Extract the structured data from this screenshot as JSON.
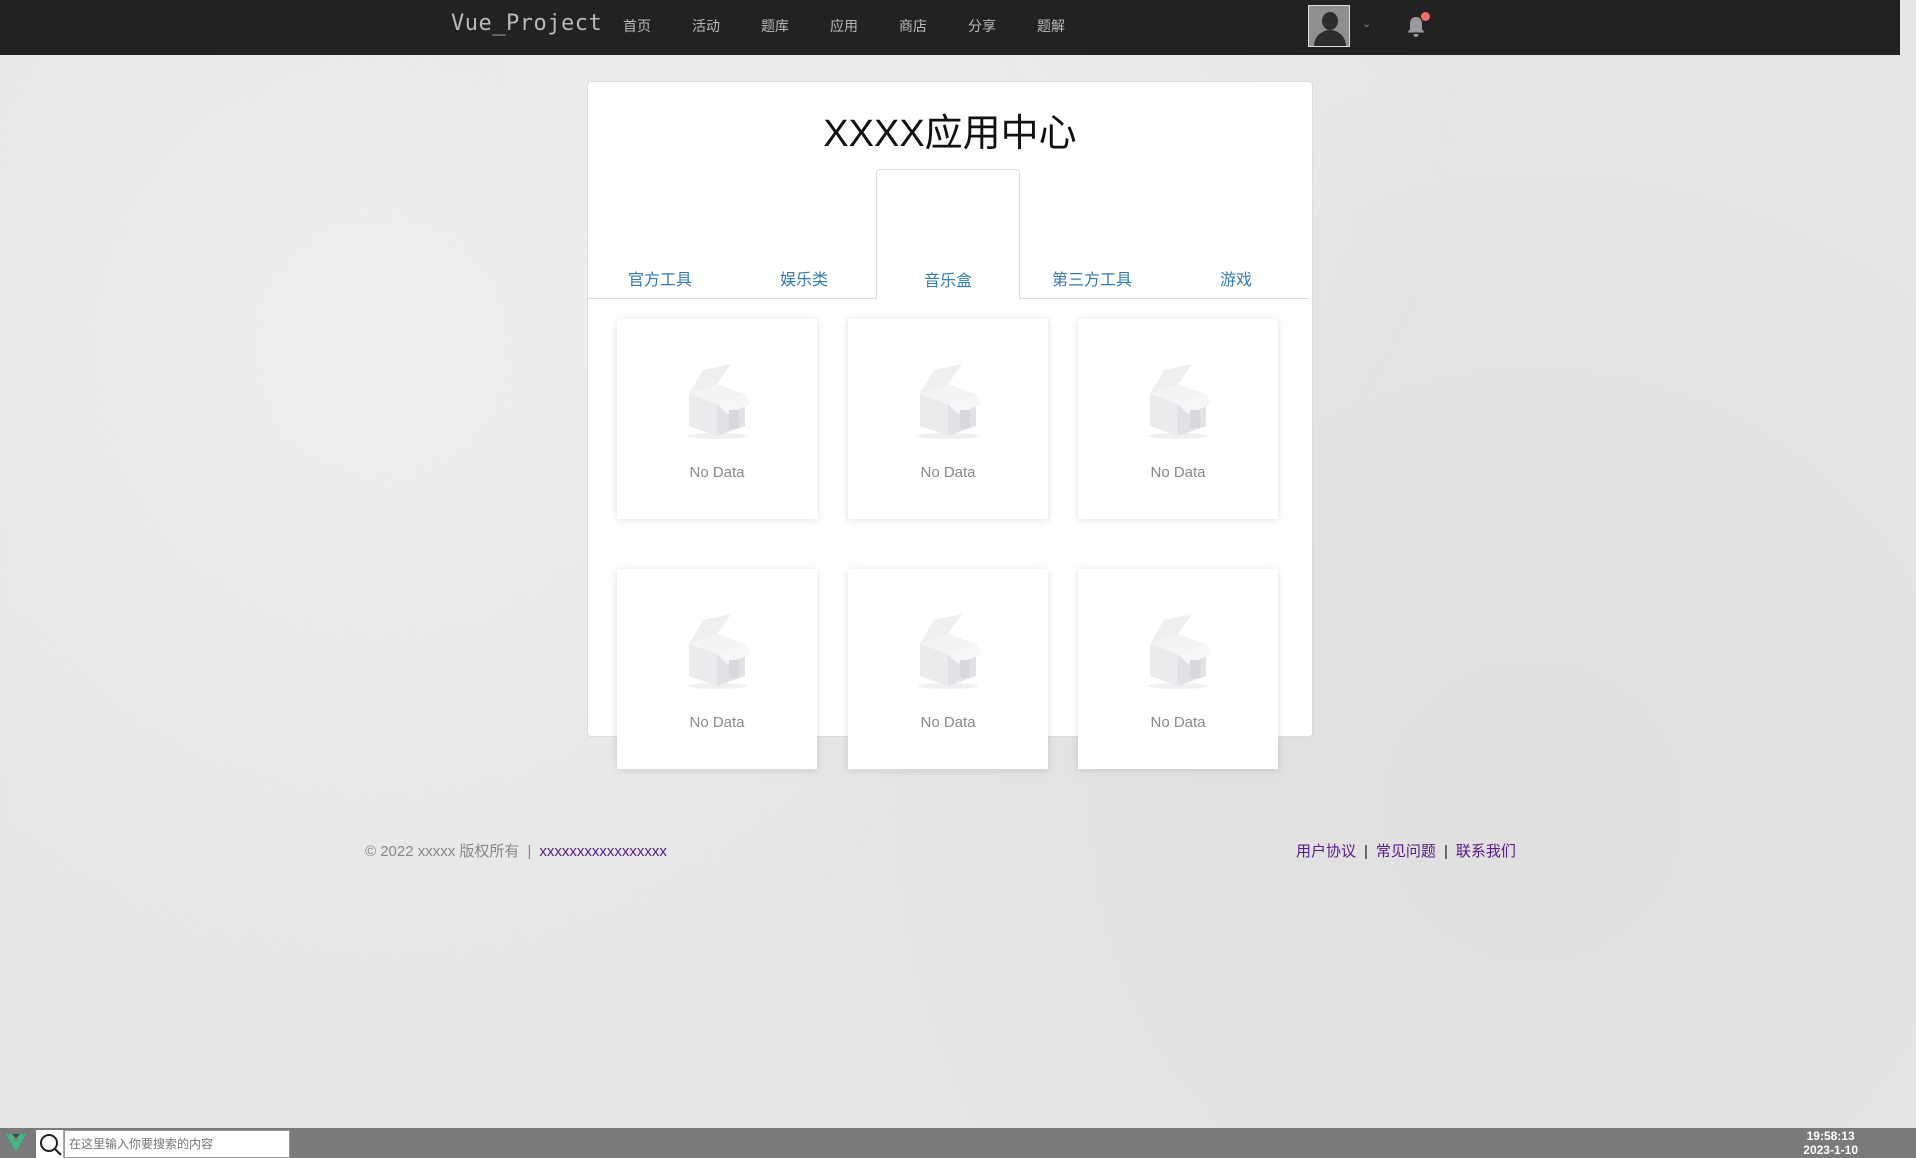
{
  "brand": "Vue_Project",
  "nav": [
    "首页",
    "活动",
    "题库",
    "应用",
    "商店",
    "分享",
    "题解"
  ],
  "header": {
    "notification_has_unread": true
  },
  "panel": {
    "title": "XXXX应用中心",
    "tabs": [
      {
        "label": "官方工具",
        "active": false
      },
      {
        "label": "娱乐类",
        "active": false
      },
      {
        "label": "音乐盒",
        "active": true
      },
      {
        "label": "第三方工具",
        "active": false
      },
      {
        "label": "游戏",
        "active": false
      }
    ],
    "cards": [
      {
        "text": "No Data"
      },
      {
        "text": "No Data"
      },
      {
        "text": "No Data"
      },
      {
        "text": "No Data"
      },
      {
        "text": "No Data"
      },
      {
        "text": "No Data"
      }
    ]
  },
  "footer": {
    "copyright": "© 2022 xxxxx 版权所有",
    "separator": "|",
    "link": "xxxxxxxxxxxxxxxxx",
    "right_links": [
      "用户协议",
      "常见问题",
      "联系我们"
    ]
  },
  "taskbar": {
    "search_placeholder": "在这里输入你要搜索的内容",
    "time": "19:58:13",
    "date": "2023-1-10"
  },
  "colors": {
    "topbar": "#222222",
    "tab_text": "#337ab7",
    "footer_link": "#551a8b",
    "notification_dot": "#f56c6c"
  }
}
